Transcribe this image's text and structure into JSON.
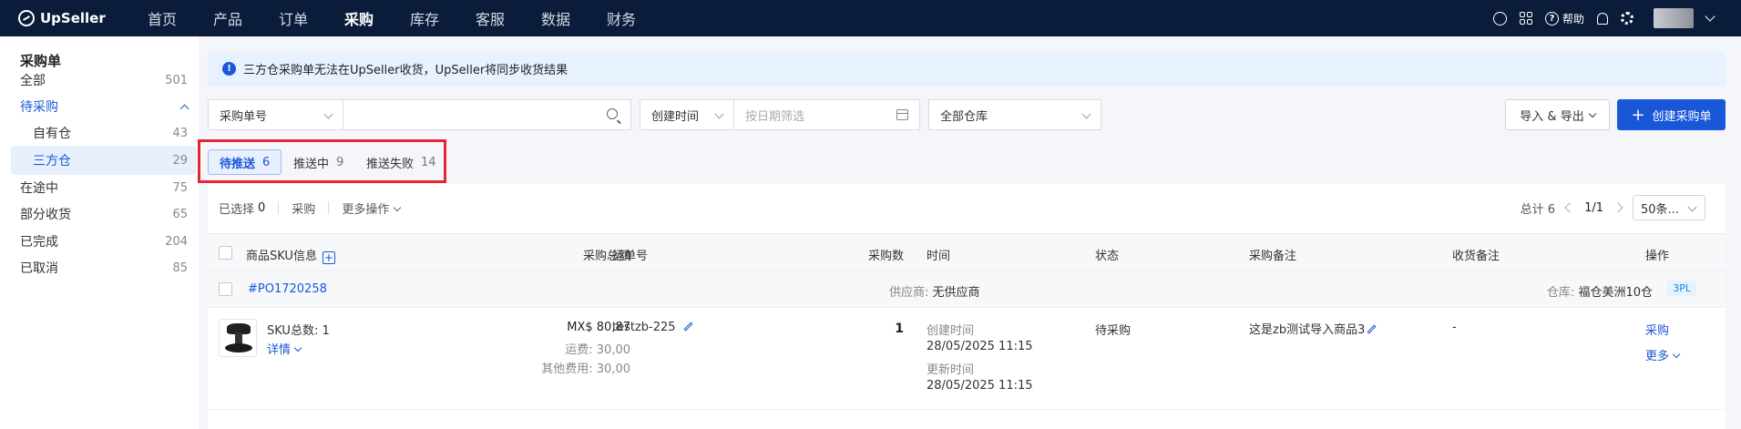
{
  "brand": {
    "name": "UpSeller"
  },
  "nav": {
    "items": [
      "首页",
      "产品",
      "订单",
      "采购",
      "库存",
      "客服",
      "数据",
      "财务"
    ],
    "active_index": 3,
    "help_label": "帮助"
  },
  "sidebar": {
    "title": "采购单",
    "items": [
      {
        "label": "全部",
        "count": "501"
      },
      {
        "label": "待采购",
        "count": ""
      },
      {
        "label": "自有仓",
        "count": "43"
      },
      {
        "label": "三方仓",
        "count": "29"
      },
      {
        "label": "在途中",
        "count": "75"
      },
      {
        "label": "部分收货",
        "count": "65"
      },
      {
        "label": "已完成",
        "count": "204"
      },
      {
        "label": "已取消",
        "count": "85"
      }
    ]
  },
  "notice": {
    "text": "三方仓采购单无法在UpSeller收货，UpSeller将同步收货结果"
  },
  "filters": {
    "search_type": "采购单号",
    "search_value": "",
    "time_type": "创建时间",
    "date_placeholder": "按日期筛选",
    "warehouse": "全部仓库"
  },
  "actions": {
    "import_export": "导入 & 导出",
    "create": "创建采购单"
  },
  "tabs": [
    {
      "label": "待推送",
      "count": "6"
    },
    {
      "label": "推送中",
      "count": "9"
    },
    {
      "label": "推送失败",
      "count": "14"
    }
  ],
  "toolbar": {
    "selected_label": "已选择",
    "selected_count": "0",
    "purchase": "采购",
    "more_ops": "更多操作",
    "total": "总计 6",
    "page": "1/1",
    "page_size": "50条..."
  },
  "table": {
    "headers": [
      "商品SKU信息",
      "采购总额",
      "运单号",
      "采购数",
      "时间",
      "状态",
      "采购备注",
      "收货备注",
      "操作"
    ]
  },
  "order": {
    "po": "#PO1720258",
    "supplier_label": "供应商:",
    "supplier": "无供应商",
    "warehouse_label": "仓库:",
    "warehouse": "福仓美洲10仓",
    "tag": "3PL",
    "sku_total": "SKU总数: 1",
    "details": "详情",
    "amount": "MX$ 80,87",
    "shipping": "运费: 30,00",
    "other_fee": "其他费用: 30,00",
    "tracking": "testzb-225",
    "qty": "1",
    "created_label": "创建时间",
    "created": "28/05/2025 11:15",
    "updated_label": "更新时间",
    "updated": "28/05/2025 11:15",
    "status": "待采购",
    "purchase_note": "这是zb测试导入商品3",
    "receive_note": "-",
    "op_purchase": "采购",
    "op_more": "更多"
  }
}
